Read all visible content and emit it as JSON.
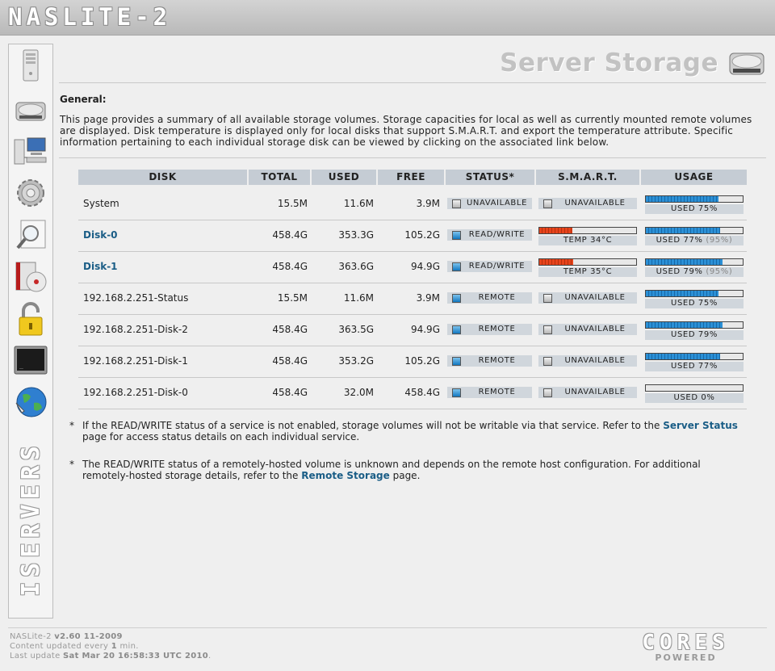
{
  "brand": {
    "logo_text": "NASLITE-2",
    "vertical_text": "ISERVERS"
  },
  "nav": [
    {
      "name": "server-icon"
    },
    {
      "name": "storage-disk-icon"
    },
    {
      "name": "network-computers-icon"
    },
    {
      "name": "settings-gear-icon"
    },
    {
      "name": "search-magnifier-icon"
    },
    {
      "name": "media-disc-icon"
    },
    {
      "name": "padlock-icon"
    },
    {
      "name": "terminal-icon"
    },
    {
      "name": "globe-icon"
    }
  ],
  "page": {
    "title": "Server Storage",
    "general_heading": "General:",
    "general_text": "This page provides a summary of all available storage volumes. Storage capacities for local as well as currently mounted remote volumes are displayed. Disk temperature is displayed only for local disks that support S.M.A.R.T. and export the temperature attribute. Specific information pertaining to each individual storage disk can be viewed by clicking on the associated link below."
  },
  "table": {
    "headers": [
      "DISK",
      "TOTAL",
      "USED",
      "FREE",
      "STATUS*",
      "S.M.A.R.T.",
      "USAGE"
    ],
    "rows": [
      {
        "disk": "System",
        "link": false,
        "total": "15.5M",
        "used": "11.6M",
        "free": "3.9M",
        "status": "UNAVAILABLE",
        "status_color": "gray",
        "smart_type": "text",
        "smart": "UNAVAILABLE",
        "temp_fraction": 0,
        "usage_fraction": 0.75,
        "usage_label": "USED 75%",
        "usage_extra": ""
      },
      {
        "disk": "Disk-0",
        "link": true,
        "total": "458.4G",
        "used": "353.3G",
        "free": "105.2G",
        "status": "READ/WRITE",
        "status_color": "blue",
        "smart_type": "temp",
        "smart": "TEMP 34°C",
        "temp_fraction": 0.34,
        "usage_fraction": 0.77,
        "usage_label": "USED 77%",
        "usage_extra": "(95%)"
      },
      {
        "disk": "Disk-1",
        "link": true,
        "total": "458.4G",
        "used": "363.6G",
        "free": "94.9G",
        "status": "READ/WRITE",
        "status_color": "blue",
        "smart_type": "temp",
        "smart": "TEMP 35°C",
        "temp_fraction": 0.35,
        "usage_fraction": 0.79,
        "usage_label": "USED 79%",
        "usage_extra": "(95%)"
      },
      {
        "disk": "192.168.2.251-Status",
        "link": false,
        "total": "15.5M",
        "used": "11.6M",
        "free": "3.9M",
        "status": "REMOTE",
        "status_color": "blue",
        "smart_type": "text",
        "smart": "UNAVAILABLE",
        "temp_fraction": 0,
        "usage_fraction": 0.75,
        "usage_label": "USED 75%",
        "usage_extra": ""
      },
      {
        "disk": "192.168.2.251-Disk-2",
        "link": false,
        "total": "458.4G",
        "used": "363.5G",
        "free": "94.9G",
        "status": "REMOTE",
        "status_color": "blue",
        "smart_type": "text",
        "smart": "UNAVAILABLE",
        "temp_fraction": 0,
        "usage_fraction": 0.79,
        "usage_label": "USED 79%",
        "usage_extra": ""
      },
      {
        "disk": "192.168.2.251-Disk-1",
        "link": false,
        "total": "458.4G",
        "used": "353.2G",
        "free": "105.2G",
        "status": "REMOTE",
        "status_color": "blue",
        "smart_type": "text",
        "smart": "UNAVAILABLE",
        "temp_fraction": 0,
        "usage_fraction": 0.77,
        "usage_label": "USED 77%",
        "usage_extra": ""
      },
      {
        "disk": "192.168.2.251-Disk-0",
        "link": false,
        "total": "458.4G",
        "used": "32.0M",
        "free": "458.4G",
        "status": "REMOTE",
        "status_color": "blue",
        "smart_type": "text",
        "smart": "UNAVAILABLE",
        "temp_fraction": 0,
        "usage_fraction": 0,
        "usage_label": "USED 0%",
        "usage_extra": ""
      }
    ]
  },
  "notes": [
    {
      "star": "*",
      "before": "If the READ/WRITE status of a service is not enabled, storage volumes will not be writable via that service. Refer to the ",
      "link": "Server Status",
      "after": " page for access status details on each individual service."
    },
    {
      "star": "*",
      "before": "The READ/WRITE status of a remotely-hosted volume is unknown and depends on the remote host configuration. For additional remotely-hosted storage details, refer to the ",
      "link": "Remote Storage",
      "after": " page."
    }
  ],
  "footer": {
    "product": "NASLite-2",
    "version": "v2.60 11-2009",
    "refresh_prefix": "Content updated every ",
    "refresh_value": "1",
    "refresh_suffix": " min.",
    "last_update_prefix": "Last update ",
    "last_update_value": "Sat Mar 20 16:58:33 UTC 2010",
    "powered_logo": "CORES",
    "powered_text": "POWERED"
  },
  "colors": {
    "link": "#1a5d86",
    "usage_fill": "#2b90d6",
    "temp_fill": "#e7441c",
    "header_bg": "#c5ccd4"
  }
}
